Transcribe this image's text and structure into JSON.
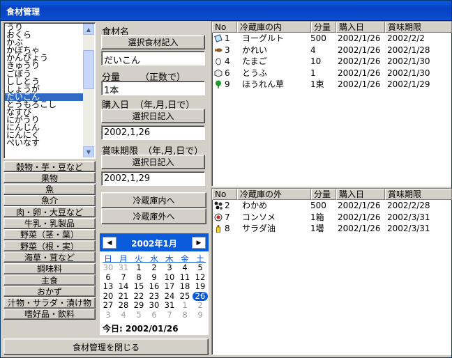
{
  "window": {
    "title": "食材管理"
  },
  "ingredients": {
    "items": [
      "うり",
      "おくら",
      "かぶ",
      "かぼちゃ",
      "かんぴょう",
      "きゅうり",
      "ごぼう",
      "ししとう",
      "しょうが",
      "だいこん",
      "とうもろこし",
      "なすび",
      "にがうり",
      "にんじん",
      "にんにく",
      "ぺいなす"
    ],
    "selected_index": 9
  },
  "categories": [
    "穀物・芋・豆など",
    "果物",
    "魚",
    "魚介",
    "肉・卵・大豆など",
    "牛乳・乳製品",
    "野菜（茎・葉）",
    "野菜（根・実）",
    "海草・茸など",
    "調味料",
    "主食",
    "おかず",
    "汁物・サラダ・漬け物",
    "嗜好品・飲料"
  ],
  "form": {
    "name_label": "食材名",
    "name_button": "選択食材記入",
    "name_value": "だいこん",
    "qty_label": "分量",
    "qty_hint": "（正数で）",
    "qty_value": "1本",
    "purchase_label": "購入日",
    "date_hint": "（年,月,日で）",
    "purchase_button": "選択日記入",
    "purchase_value": "2002,1,26",
    "expiry_label": "賞味期限",
    "expiry_button": "選択日記入",
    "expiry_value": "2002,1,29",
    "to_inside_button": "冷蔵庫内へ",
    "to_outside_button": "冷蔵庫外へ"
  },
  "calendar": {
    "title": "2002年1月",
    "prev_icon": "triangle-left-icon",
    "next_icon": "triangle-right-icon",
    "weekdays": [
      "日",
      "月",
      "火",
      "水",
      "木",
      "金",
      "土"
    ],
    "days": [
      [
        "30",
        "31",
        "1",
        "2",
        "3",
        "4",
        "5"
      ],
      [
        "6",
        "7",
        "8",
        "9",
        "10",
        "11",
        "12"
      ],
      [
        "13",
        "14",
        "15",
        "16",
        "17",
        "18",
        "19"
      ],
      [
        "20",
        "21",
        "22",
        "23",
        "24",
        "25",
        "26"
      ],
      [
        "27",
        "28",
        "29",
        "30",
        "31",
        "1",
        "2"
      ],
      [
        "3",
        "4",
        "5",
        "6",
        "7",
        "8",
        "9"
      ]
    ],
    "today_label": "今日: 2002/01/26"
  },
  "close_button": "食材管理を閉じる",
  "inside_table": {
    "headers": [
      "No",
      "冷蔵庫の内",
      "分量",
      "購入日",
      "賞味期限"
    ],
    "rows": [
      {
        "no": "1",
        "name": "ヨーグルト",
        "qty": "500",
        "bought": "2002/1/26",
        "expiry": "2002/2/2",
        "icon": "yogurt-icon"
      },
      {
        "no": "3",
        "name": "かれい",
        "qty": "4",
        "bought": "2002/1/26",
        "expiry": "2002/1/28",
        "icon": "fish-icon"
      },
      {
        "no": "4",
        "name": "たまご",
        "qty": "10",
        "bought": "2002/1/26",
        "expiry": "2002/1/30",
        "icon": "egg-icon"
      },
      {
        "no": "6",
        "name": "とうふ",
        "qty": "1",
        "bought": "2002/1/26",
        "expiry": "2002/1/30",
        "icon": "tofu-icon"
      },
      {
        "no": "9",
        "name": "ほうれん草",
        "qty": "1束",
        "bought": "2002/1/26",
        "expiry": "2002/1/29",
        "icon": "spinach-icon"
      }
    ]
  },
  "outside_table": {
    "headers": [
      "No",
      "冷蔵庫の外",
      "分量",
      "購入日",
      "賞味期限"
    ],
    "rows": [
      {
        "no": "2",
        "name": "わかめ",
        "qty": "500",
        "bought": "2002/1/26",
        "expiry": "2002/2/28",
        "icon": "seaweed-icon"
      },
      {
        "no": "7",
        "name": "コンソメ",
        "qty": "1箱",
        "bought": "2002/1/26",
        "expiry": "2002/3/31",
        "icon": "consomme-icon"
      },
      {
        "no": "8",
        "name": "サラダ油",
        "qty": "1壜",
        "bought": "2002/1/26",
        "expiry": "2002/3/31",
        "icon": "oil-bottle-icon"
      }
    ]
  },
  "colors": {
    "title_bar": "#0a5bdc",
    "selection": "#316ac5",
    "calendar_accent": "#0a5bdc"
  }
}
